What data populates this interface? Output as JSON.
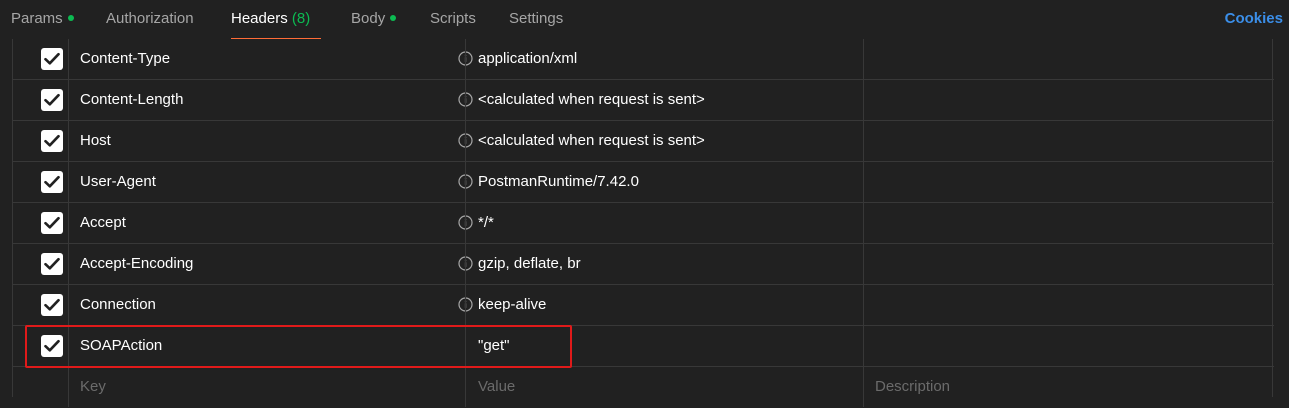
{
  "tabs": [
    {
      "label": "Params",
      "dot": true
    },
    {
      "label": "Authorization"
    },
    {
      "label": "Headers",
      "count": "(8)",
      "active": true
    },
    {
      "label": "Body",
      "dot": true
    },
    {
      "label": "Scripts"
    },
    {
      "label": "Settings"
    }
  ],
  "cookies_label": "Cookies",
  "headers": [
    {
      "key": "Content-Type",
      "value": "application/xml",
      "checked": true,
      "info": true
    },
    {
      "key": "Content-Length",
      "value": "<calculated when request is sent>",
      "checked": true,
      "info": true
    },
    {
      "key": "Host",
      "value": "<calculated when request is sent>",
      "checked": true,
      "info": true
    },
    {
      "key": "User-Agent",
      "value": "PostmanRuntime/7.42.0",
      "checked": true,
      "info": true
    },
    {
      "key": "Accept",
      "value": "*/*",
      "checked": true,
      "info": true
    },
    {
      "key": "Accept-Encoding",
      "value": "gzip, deflate, br",
      "checked": true,
      "info": true
    },
    {
      "key": "Connection",
      "value": "keep-alive",
      "checked": true,
      "info": true
    },
    {
      "key": "SOAPAction",
      "value": "\"get\"",
      "checked": true,
      "info": false
    }
  ],
  "new_row": {
    "key_placeholder": "Key",
    "value_placeholder": "Value",
    "description_placeholder": "Description"
  },
  "colors": {
    "background": "#212121",
    "active_tab_underline": "#ff6c37",
    "status_dot": "#0cbb52",
    "link": "#3b8ee8",
    "highlight_box": "#e01a1a"
  }
}
